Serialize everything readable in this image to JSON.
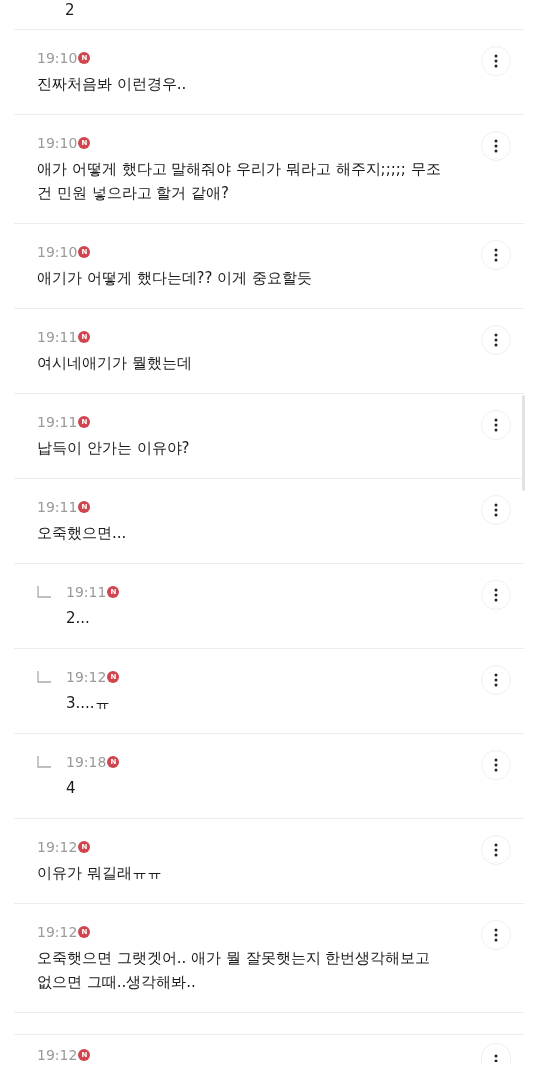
{
  "top_fragment": {
    "text": "2"
  },
  "comments": [
    {
      "time": "19:10",
      "badge": "N",
      "text": "진짜처음봐 이런경우.."
    },
    {
      "time": "19:10",
      "badge": "N",
      "text": "애가 어떻게 했다고 말해줘야 우리가 뭐라고 해주지;;;;; 무조건 민원 넣으라고 할거 같애?"
    },
    {
      "time": "19:10",
      "badge": "N",
      "text": "애기가 어떻게 했다는데?? 이게 중요할듯"
    },
    {
      "time": "19:11",
      "badge": "N",
      "text": "여시네애기가 뭘했는데"
    },
    {
      "time": "19:11",
      "badge": "N",
      "text": "납득이 안가는 이유야?"
    },
    {
      "time": "19:11",
      "badge": "N",
      "text": "오죽했으면...",
      "children": [
        {
          "time": "19:11",
          "badge": "N",
          "text": "2..."
        },
        {
          "time": "19:12",
          "badge": "N",
          "text": "3....ㅠ"
        },
        {
          "time": "19:18",
          "badge": "N",
          "text": "4"
        }
      ]
    },
    {
      "time": "19:12",
      "badge": "N",
      "text": "이유가 뭐길래ㅠㅠ"
    },
    {
      "time": "19:12",
      "badge": "N",
      "text": "오죽햇으면 그랫겟어.. 애가 뭘 잘못햇는지 한번생각해보고 없으면 그때..생각해봐.."
    }
  ],
  "last_comment": {
    "time": "19:12",
    "badge": "N"
  }
}
